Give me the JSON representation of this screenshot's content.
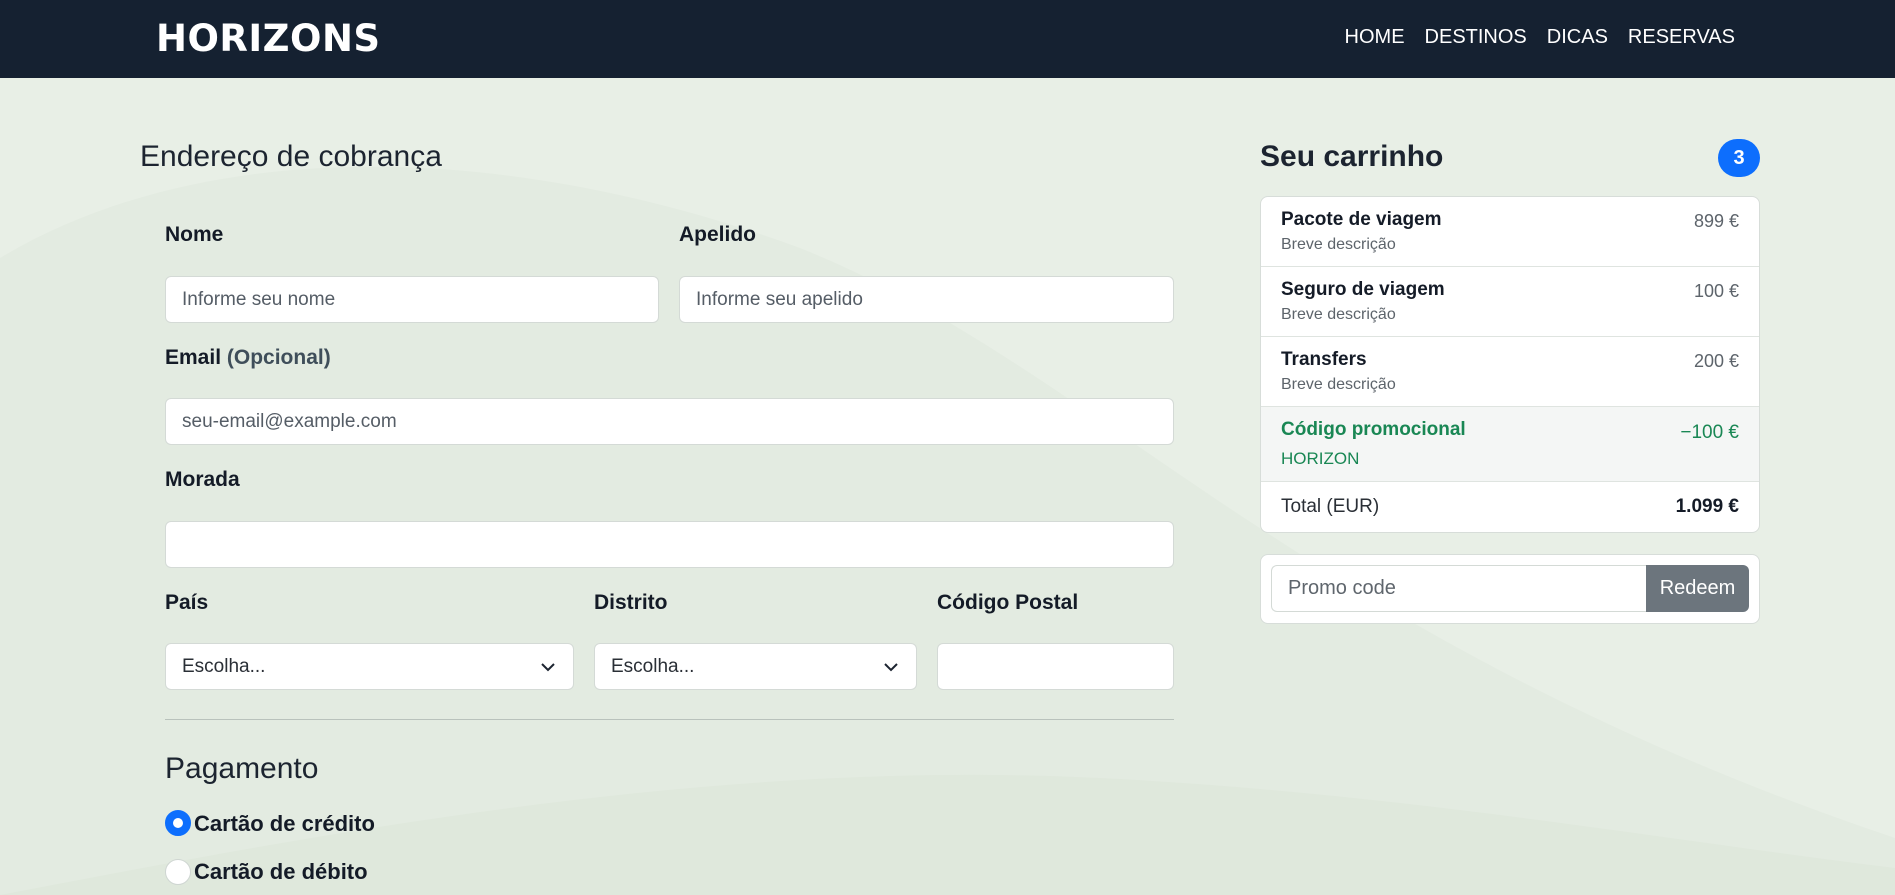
{
  "header": {
    "brand": "HORIZONS",
    "nav": [
      "HOME",
      "DESTINOS",
      "DICAS",
      "RESERVAS"
    ]
  },
  "billing": {
    "title": "Endereço de cobrança",
    "first_name": {
      "label": "Nome",
      "placeholder": "Informe seu nome"
    },
    "last_name": {
      "label": "Apelido",
      "placeholder": "Informe seu apelido"
    },
    "email": {
      "label": "Email",
      "optional": "(Opcional)",
      "placeholder": "seu-email@example.com"
    },
    "address": {
      "label": "Morada",
      "value": ""
    },
    "country": {
      "label": "País",
      "selected": "Escolha..."
    },
    "district": {
      "label": "Distrito",
      "selected": "Escolha..."
    },
    "postal_code": {
      "label": "Código Postal",
      "value": ""
    }
  },
  "payment": {
    "title": "Pagamento",
    "options": [
      {
        "label": "Cartão de crédito",
        "checked": true
      },
      {
        "label": "Cartão de débito",
        "checked": false
      }
    ]
  },
  "cart": {
    "title": "Seu carrinho",
    "count": "3",
    "items": [
      {
        "name": "Pacote de viagem",
        "description": "Breve descrição",
        "price": "899 €"
      },
      {
        "name": "Seguro de viagem",
        "description": "Breve descrição",
        "price": "100 €"
      },
      {
        "name": "Transfers",
        "description": "Breve descrição",
        "price": "200 €"
      }
    ],
    "promo": {
      "label": "Código promocional",
      "code": "HORIZON",
      "discount": "−100 €"
    },
    "total": {
      "label": "Total (EUR)",
      "value": "1.099 €"
    },
    "promo_input": {
      "placeholder": "Promo code",
      "button": "Redeem"
    }
  },
  "colors": {
    "navbar": "#152131",
    "page_background": "#e8efe6",
    "accent_blue": "#0d6efd",
    "promo_green": "#198754",
    "redeem_gray": "#6c757d"
  }
}
